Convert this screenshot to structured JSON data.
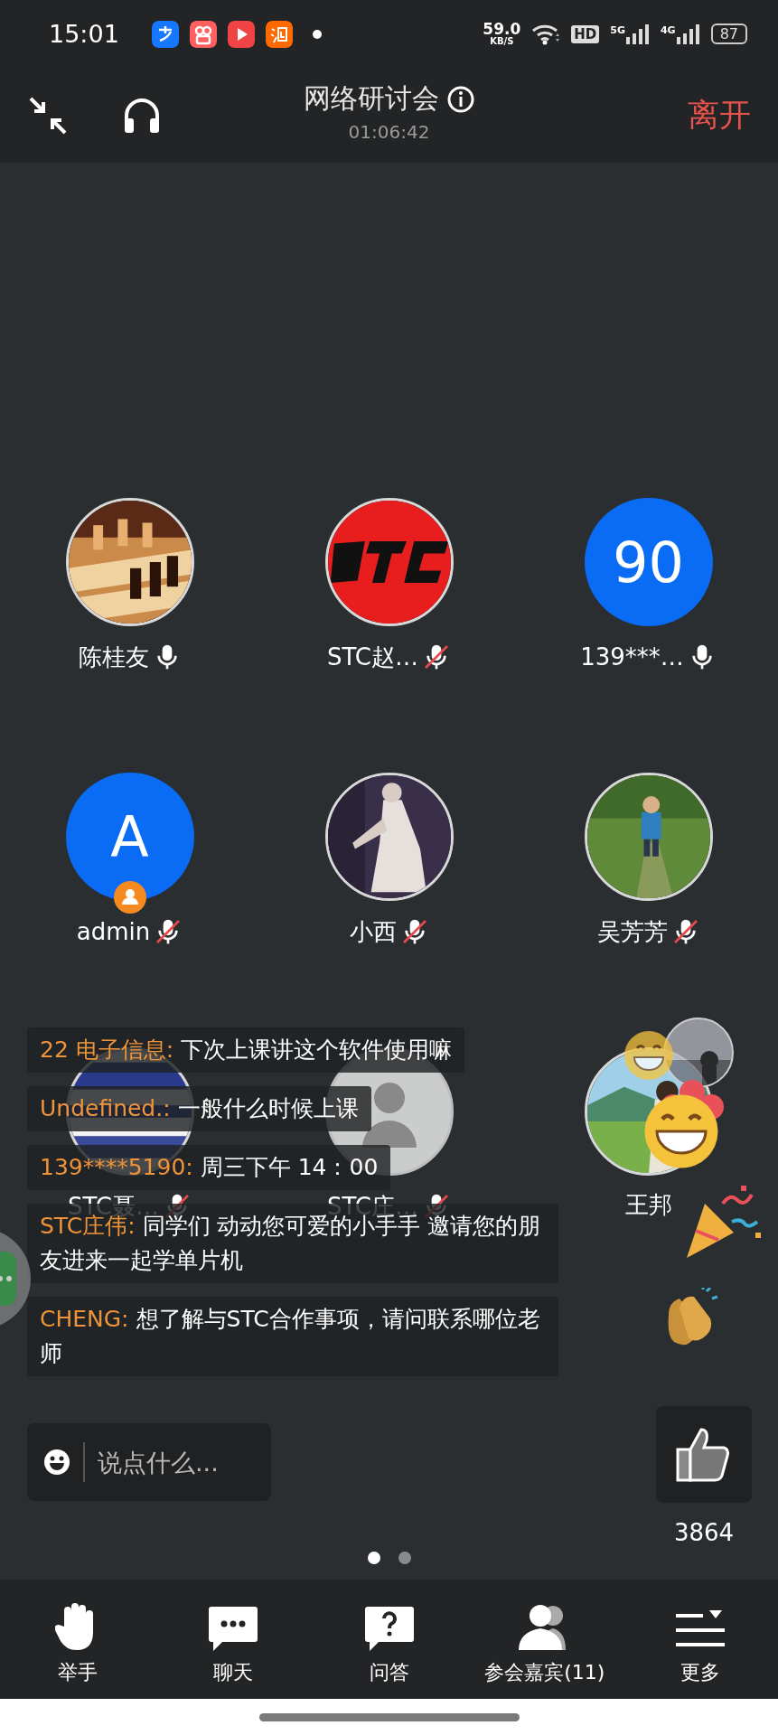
{
  "status_bar": {
    "time": "15:01",
    "speed": "59.0",
    "speed_unit": "KB/S",
    "hd": "HD",
    "network_1": "5G",
    "network_2": "4G",
    "battery": "87"
  },
  "header": {
    "title": "网络研讨会",
    "elapsed": "01:06:42",
    "leave": "离开"
  },
  "participants": [
    {
      "name": "陈桂友",
      "muted": false,
      "host": false
    },
    {
      "name": "STC赵…",
      "muted": true,
      "host": false
    },
    {
      "name": "139***…",
      "avatar": {
        "kind": "letter",
        "text": "90"
      },
      "muted": false,
      "host": false
    },
    {
      "name": "admin",
      "avatar": {
        "kind": "letter",
        "text": "A"
      },
      "muted": true,
      "host": true
    },
    {
      "name": "小西",
      "muted": true,
      "host": false
    },
    {
      "name": "吴芳芳",
      "muted": true,
      "host": false
    },
    {
      "name": "STC聂…",
      "muted": true,
      "host": false
    },
    {
      "name": "STC庄…",
      "avatar": {
        "kind": "default"
      },
      "muted": true,
      "host": false
    },
    {
      "name": "王邦",
      "host": false
    }
  ],
  "chat": [
    {
      "sender": "22 电子信息:",
      "text": "下次上课讲这个软件使用嘛"
    },
    {
      "sender": "Undefined.:",
      "text": "一般什么时候上课"
    },
    {
      "sender": "139****5190:",
      "text": "周三下午 14：00"
    },
    {
      "sender": "STC庄伟:",
      "text": "同学们  动动您可爱的小手手 邀请您的朋友进来一起学单片机"
    },
    {
      "sender": "CHENG:",
      "text": "想了解与STC合作事项，请问联系哪位老师"
    }
  ],
  "input": {
    "placeholder": "说点什么..."
  },
  "likes": {
    "count": "3864"
  },
  "pages": [
    {
      "selected": true
    },
    {
      "selected": false
    }
  ],
  "nav": [
    {
      "kind": "hand",
      "label": "举手"
    },
    {
      "kind": "chat",
      "label": "聊天"
    },
    {
      "kind": "qa",
      "label": "问答"
    },
    {
      "kind": "people",
      "label": "参会嘉宾(11)"
    },
    {
      "kind": "more",
      "label": "更多"
    }
  ]
}
